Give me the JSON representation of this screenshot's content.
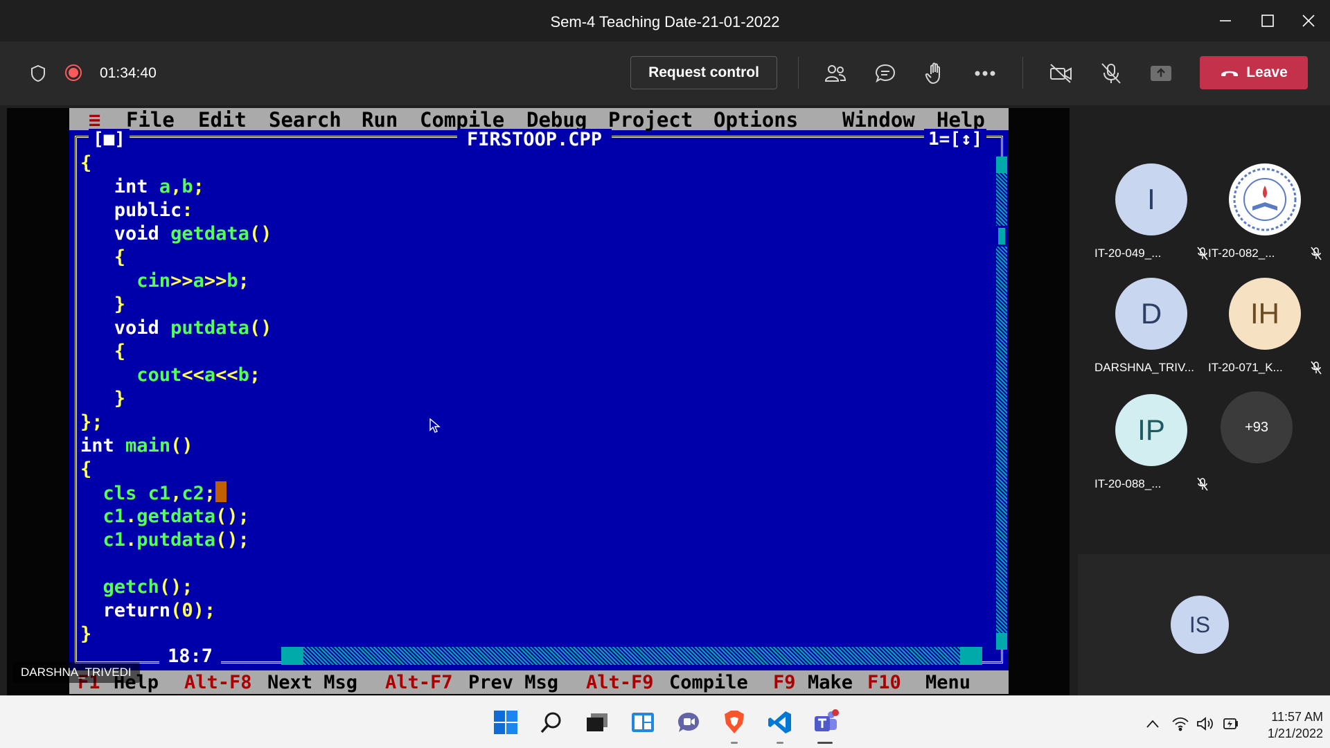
{
  "window": {
    "title": "Sem-4 Teaching Date-21-01-2022"
  },
  "toolbar": {
    "elapsed_time": "01:34:40",
    "request_control_label": "Request control",
    "leave_label": "Leave",
    "icons": [
      "people-icon",
      "chat-icon",
      "raise-hand-icon",
      "more-icon",
      "camera-off-icon",
      "mic-off-icon",
      "share-tray-icon"
    ],
    "leave_color": "#c4314b"
  },
  "shared_screen": {
    "presenter_name": "DARSHNA_TRIVEDI",
    "ide": {
      "menu": [
        "≡",
        "File",
        "Edit",
        "Search",
        "Run",
        "Compile",
        "Debug",
        "Project",
        "Options",
        "Window",
        "Help"
      ],
      "window_left_marker": "[■]",
      "file_name": "FIRSTOOP.CPP",
      "window_right_marker": "1=[↕]",
      "cursor_position": "18:7",
      "code_lines": [
        "{",
        "   int a,b;",
        "   public:",
        "   void getdata()",
        "   {",
        "     cin>>a>>b;",
        "   }",
        "   void putdata()",
        "   {",
        "     cout<<a<<b;",
        "   }",
        "};",
        "int main()",
        "{",
        "  cls c1,c2;",
        "  c1.getdata();",
        "  c1.putdata();",
        "",
        "  getch();",
        "  return(0);",
        "}"
      ],
      "status_bar": [
        {
          "key": "F1",
          "label": "Help"
        },
        {
          "key": "Alt-F8",
          "label": "Next Msg"
        },
        {
          "key": "Alt-F7",
          "label": "Prev Msg"
        },
        {
          "key": "Alt-F9",
          "label": "Compile"
        },
        {
          "key": "F9",
          "label": "Make"
        },
        {
          "key": "F10",
          "label": "Menu"
        }
      ],
      "colors": {
        "background": "#0000aa",
        "keyword": "#ffffff",
        "identifier": "#55ff55",
        "punct": "#ffff55",
        "menu_bg": "#aaaaaa",
        "hotkey": "#aa0000"
      }
    }
  },
  "participants": [
    {
      "initials": "I",
      "name": "IT-20-049_...",
      "muted": true,
      "avatar_color": "#c9d6ef"
    },
    {
      "initials": "",
      "name": "IT-20-082_...",
      "muted": true,
      "avatar_color": "#ffffff",
      "logo": true
    },
    {
      "initials": "D",
      "name": "DARSHNA_TRIV...",
      "muted": false,
      "avatar_color": "#c9d6ef"
    },
    {
      "initials": "IH",
      "name": "IT-20-071_K...",
      "muted": true,
      "avatar_color": "#f6e2c3"
    },
    {
      "initials": "IP",
      "name": "IT-20-088_...",
      "muted": true,
      "avatar_color": "#d2eef1"
    }
  ],
  "more_participants": "+93",
  "self_view": {
    "initials": "IS"
  },
  "taskbar": {
    "apps": [
      "windows-start-icon",
      "search-icon",
      "task-view-icon",
      "widgets-icon",
      "teams-chat-icon",
      "brave-icon",
      "vscode-icon",
      "teams-icon"
    ],
    "time": "11:57 AM",
    "date": "1/21/2022"
  }
}
